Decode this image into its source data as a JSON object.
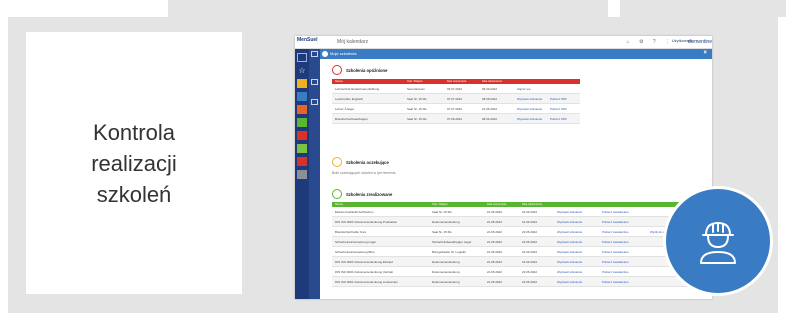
{
  "card": {
    "lines": [
      "Kontrola",
      "realizacji",
      "szkoleń"
    ]
  },
  "screenshot": {
    "logo_text": "MenSuel",
    "window_title": "Mój kalendarz",
    "user_label": "Użytkownik",
    "brand": "clementine",
    "modal_title": "Moje szkolenia",
    "sections": {
      "overdue": {
        "title": "Szkolenia opóźnione",
        "columns": [
          "Nazwa",
          "Opis / Miejsce",
          "Data rozpoczęcia",
          "Data zakończenia",
          ""
        ],
        "rows": [
          [
            "Lehrtechnik Erwachsenenbildung",
            "Seminarraum",
            "03.07.2022",
            "06.09.2022",
            "Zapisz się"
          ],
          [
            "Leitertreffen Englisch",
            "Saal Nr. 15 Mo",
            "07.07.2022",
            "08.08.2022",
            "Wyświetl szkolenie",
            "Pobierz PDF"
          ],
          [
            "Lehrer Ã Eiger",
            "Saal Nr. 15 Mo",
            "07.07.2022",
            "21.06.2022",
            "Wyświetl szkolenie",
            "Pobierz PDF"
          ],
          [
            "Brandschutzbeauftragter",
            "Saal Nr. 15 Mo",
            "07.06.2022",
            "08.06.2022",
            "Wyświetl szkolenie",
            "Pobierz PDF"
          ]
        ]
      },
      "pending": {
        "title": "Szkolenia oczekujące",
        "note": "Brak oczekujących szkoleń w tym terminie."
      },
      "completed": {
        "title": "Szkolenia zrealizowane",
        "columns": [
          "Nazwa",
          "Opis / Miejsce",
          "Data rozpoczęcia",
          "Data zakończenia",
          ""
        ],
        "rows": [
          [
            "Elektro-Fachkraft Auffrischen",
            "Saal Nr. 15 Mo",
            "21.06.2022",
            "22.06.2022",
            "Wyświetl szkolenie",
            "Pobierz świadectwo"
          ],
          [
            "DIN ISO 9001 Dokumentenlenkung Produktion",
            "Dokumentenlenkung",
            "21.06.2022",
            "21.06.2022",
            "Wyświetl szkolenie",
            "Pobierz świadectwo"
          ],
          [
            "Brandschutzhelfer Kurs",
            "Saal Nr. 15 Mo",
            "21.06.2022",
            "22.06.2022",
            "Wyświetl szkolenie",
            "Pobierz świadectwo",
            "Wyślij do opinii"
          ],
          [
            "Sicherheitsunterweisung Lager",
            "Sicherheitsbeauftragter Lager",
            "21.06.2022",
            "22.06.2022",
            "Wyświetl szkolenie",
            "Pobierz świadectwo"
          ],
          [
            "Sicherheitsunterweisung Büro",
            "Bürogebäude Nr. Logistik",
            "21.06.2022",
            "22.06.2022",
            "Wyświetl szkolenie",
            "Pobierz świadectwo"
          ],
          [
            "DIN ISO 9001 Dokumentenlenkung Einkauf",
            "Dokumentenlenkung",
            "21.06.2022",
            "22.06.2022",
            "Wyświetl szkolenie",
            "Pobierz świadectwo"
          ],
          [
            "DIN ISO 9001 Dokumentenlenkung Vertrieb",
            "Dokumentenlenkung",
            "21.06.2022",
            "22.06.2022",
            "Wyświetl szkolenie",
            "Pobierz świadectwo"
          ],
          [
            "DIN ISO 9001 Dokumentenlenkung Lieferanten",
            "Dokumentenlenkung",
            "21.06.2022",
            "22.06.2022",
            "Wyświetl szkolenie",
            "Pobierz świadectwo"
          ]
        ]
      }
    }
  },
  "colors": {
    "panel": "#e4e4e4",
    "sidebar": "#1f3a7a",
    "accent_blue": "#3a7cc4",
    "overdue_red": "#d8322b",
    "pending_amber": "#f0b020",
    "completed_green": "#5ab532"
  },
  "icons": {
    "badge": "construction-worker-icon"
  }
}
